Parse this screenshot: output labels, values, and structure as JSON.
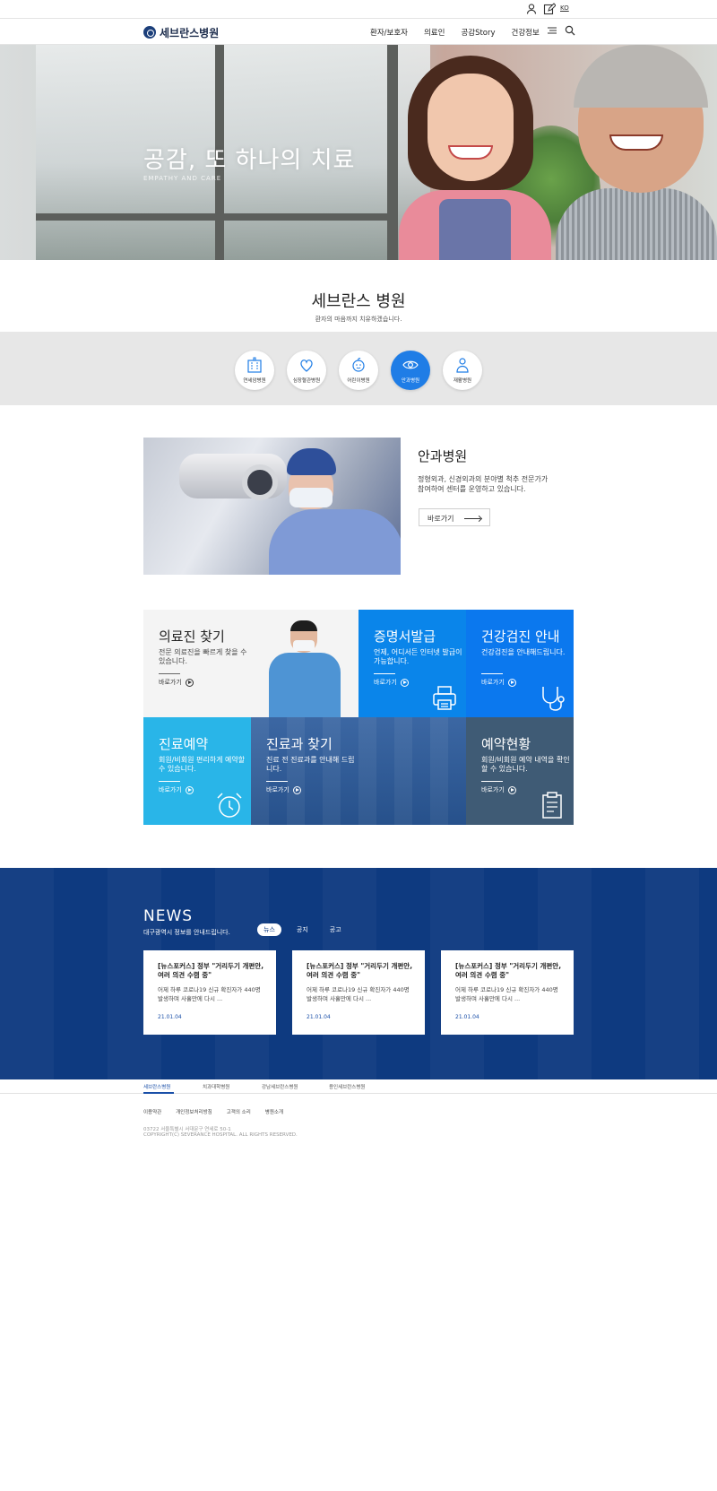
{
  "utility": {
    "lang": "KO"
  },
  "header": {
    "logo": "세브란스병원",
    "nav": [
      "환자/보호자",
      "의료인",
      "공감Story",
      "건강정보"
    ]
  },
  "hero": {
    "title": "공감, 또 하나의 치료",
    "subtitle": "EMPATHY AND CARE"
  },
  "section": {
    "title": "세브란스 병원",
    "subtitle": "환자의 마음까지 치유하겠습니다."
  },
  "hospitals": [
    {
      "label": "연세암병원",
      "icon": "building-icon"
    },
    {
      "label": "심장혈관병원",
      "icon": "heart-icon"
    },
    {
      "label": "어린이병원",
      "icon": "child-icon"
    },
    {
      "label": "안과병원",
      "icon": "eye-icon",
      "active": true
    },
    {
      "label": "재활병원",
      "icon": "person-icon"
    }
  ],
  "featured": {
    "name": "안과병원",
    "desc": "정형외과, 신경외과의 분야별 척추 전문가가 참여하여 센터를 운영하고 있습니다.",
    "button": "바로가기"
  },
  "tiles": [
    {
      "title": "의료진 찾기",
      "desc": "전문 의료진을 빠르게 찾을 수 있습니다.",
      "go": "바로가기"
    },
    {
      "title": "증명서발급",
      "desc": "언제, 어디서든 인터넷 발급이 가능합니다.",
      "go": "바로가기",
      "icon": "printer-icon"
    },
    {
      "title": "건강검진 안내",
      "desc": "건강검진을 안내해드립니다.",
      "go": "바로가기",
      "icon": "stethoscope-icon"
    },
    {
      "title": "진료예약",
      "desc": "회원/비회원 편리하게 예약할 수 있습니다.",
      "go": "바로가기",
      "icon": "alarm-clock-icon"
    },
    {
      "title": "진료과 찾기",
      "desc": "진료 전 진료과를 안내해 드립니다.",
      "go": "바로가기"
    },
    {
      "title": "예약현황",
      "desc": "회원/비회원 예약 내역을 확인 할 수 있습니다.",
      "go": "바로가기",
      "icon": "clipboard-icon"
    }
  ],
  "colors": {
    "accent": "#1f7de6",
    "newsBg": "#0e3a80",
    "tileCyan": "#29b5e8",
    "tileBlue": "#0a85ea",
    "tileBlue2": "#0b78ee",
    "tileSlate": "#3f5b75",
    "tileNavy": "#2b5a9b"
  },
  "news": {
    "title": "NEWS",
    "subtitle": "대구광역시 정보를 안내드립니다.",
    "tabs": [
      "뉴스",
      "공지",
      "공고"
    ],
    "items": [
      {
        "headline": "[뉴스포커스] 정부 \"거리두기 개편안, 여러 의견 수렴 중\"",
        "body": "어제 하루 코로나19 신규 확진자가 440명 발생하며 사흘만에 다시 ...",
        "date": "21.01.04"
      },
      {
        "headline": "[뉴스포커스] 정부 \"거리두기 개편안, 여러 의견 수렴 중\"",
        "body": "어제 하루 코로나19 신규 확진자가 440명 발생하며 사흘만에 다시 ...",
        "date": "21.01.04"
      },
      {
        "headline": "[뉴스포커스] 정부 \"거리두기 개편안, 여러 의견 수렴 중\"",
        "body": "어제 하루 코로나19 신규 확진자가 440명 발생하며 사흘만에 다시 ...",
        "date": "21.01.04"
      }
    ]
  },
  "family": [
    "세브란스병원",
    "치과대학병원",
    "강남세브란스병원",
    "용인세브란스병원"
  ],
  "footer": {
    "links": [
      "이용약관",
      "개인정보처리방침",
      "고객의 소리",
      "병원소개"
    ],
    "address": "03722 서울특별시 서대문구 연세로 50-1",
    "copyright": "COPYRIGHT(C) SEVERANCE HOSPITAL. ALL RIGHTS RESERVED."
  }
}
